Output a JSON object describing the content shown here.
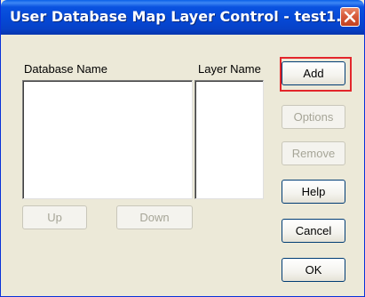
{
  "window": {
    "title": "User Database Map Layer Control - test1..."
  },
  "labels": {
    "database_name": "Database Name",
    "layer_name": "Layer Name"
  },
  "buttons": {
    "add": "Add",
    "options": "Options",
    "remove": "Remove",
    "help": "Help",
    "cancel": "Cancel",
    "ok": "OK",
    "up": "Up",
    "down": "Down"
  },
  "states": {
    "options_enabled": false,
    "remove_enabled": false,
    "up_enabled": false,
    "down_enabled": false
  },
  "annotation": {
    "highlight_color": "#e3262b",
    "highlighted_button": "add"
  },
  "colors": {
    "titlebar": "#0548d6",
    "dialog_bg": "#ece9d8",
    "close_button": "#d75b3c"
  }
}
